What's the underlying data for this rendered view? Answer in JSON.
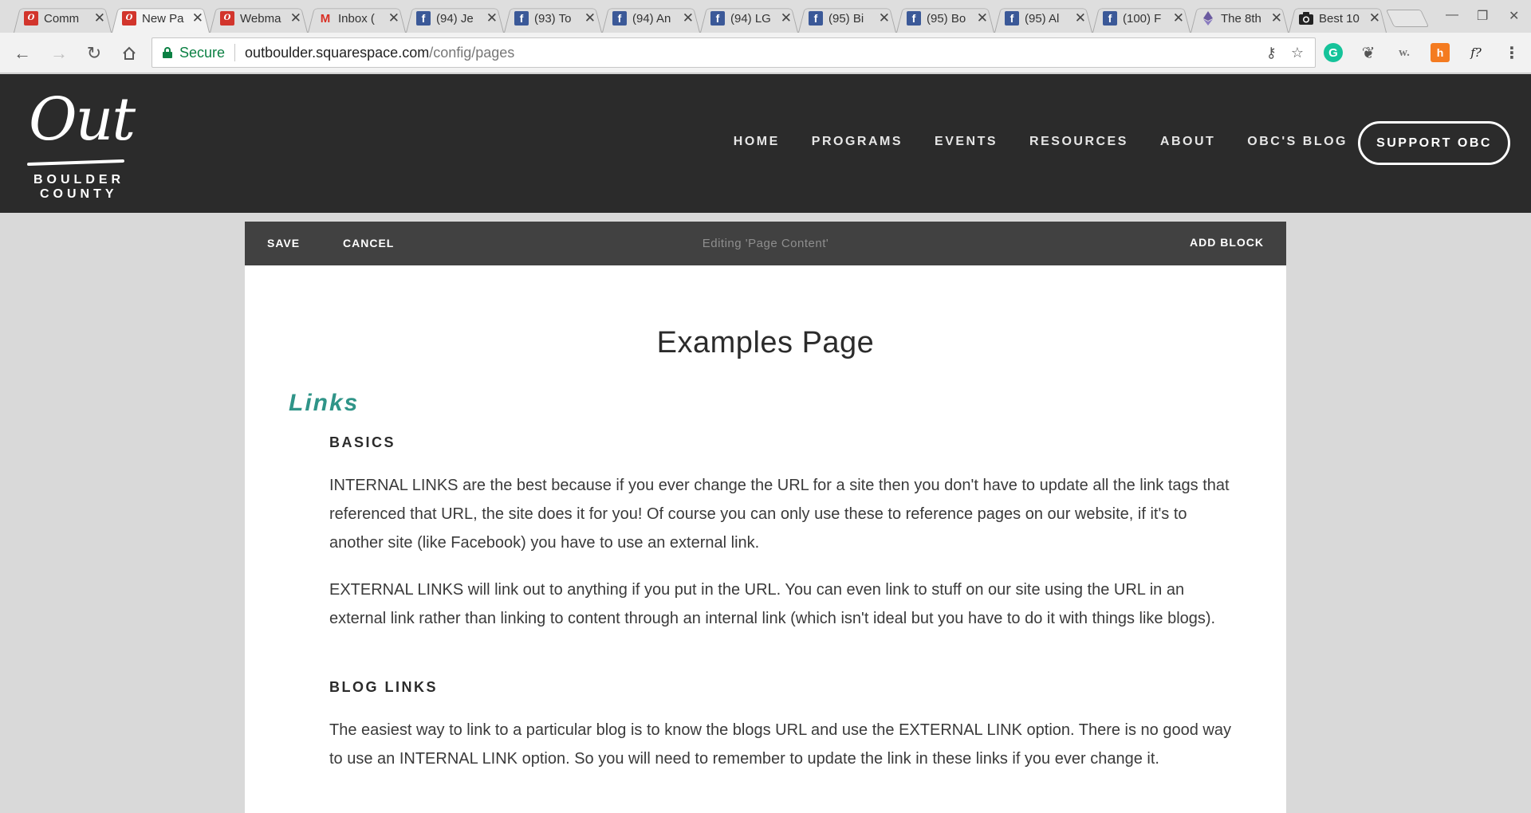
{
  "browser": {
    "tabs": [
      {
        "title": "Comm",
        "favicon": "out-logo-icon"
      },
      {
        "title": "New Pa",
        "favicon": "out-logo-icon",
        "active": true
      },
      {
        "title": "Webma",
        "favicon": "out-logo-icon"
      },
      {
        "title": "Inbox (",
        "favicon": "gmail-icon"
      },
      {
        "title": "(94) Je",
        "favicon": "facebook-icon"
      },
      {
        "title": "(93) To",
        "favicon": "facebook-icon"
      },
      {
        "title": "(94) An",
        "favicon": "facebook-icon"
      },
      {
        "title": "(94) LG",
        "favicon": "facebook-icon"
      },
      {
        "title": "(95) Bi",
        "favicon": "facebook-icon"
      },
      {
        "title": "(95) Bo",
        "favicon": "facebook-icon"
      },
      {
        "title": "(95) Al",
        "favicon": "facebook-icon"
      },
      {
        "title": "(100) F",
        "favicon": "facebook-icon"
      },
      {
        "title": "The 8th",
        "favicon": "ethereum-icon"
      },
      {
        "title": "Best 10",
        "favicon": "camera-icon"
      }
    ],
    "omnibox": {
      "secure_label": "Secure",
      "host": "outboulder.squarespace.com",
      "path": "/config/pages"
    }
  },
  "site": {
    "logo": {
      "wordmark": "Out",
      "line1": "BOULDER",
      "line2": "COUNTY"
    },
    "nav": [
      "HOME",
      "PROGRAMS",
      "EVENTS",
      "RESOURCES",
      "ABOUT",
      "OBC'S BLOG"
    ],
    "support_button": "SUPPORT OBC"
  },
  "editor": {
    "save": "SAVE",
    "cancel": "CANCEL",
    "status": "Editing 'Page Content'",
    "add_block": "ADD BLOCK"
  },
  "content": {
    "page_title": "Examples Page",
    "section_heading": "Links",
    "basics_heading": "BASICS",
    "internal_links_text": "INTERNAL LINKS are the best because if you ever change the URL for a site then you don't have to update all the link tags that referenced that URL, the site does it for you! Of course you can only use these to reference pages on our website, if it's to another site (like Facebook) you have to use an external link.",
    "external_links_text": "EXTERNAL LINKS will link out to anything if you put in the URL. You can even link to stuff on our site using the URL in an external link rather than linking to content through an internal link (which isn't ideal but you have to do it with things like blogs).",
    "blog_links_heading": "BLOG LINKS",
    "blog_links_text": "The easiest way to link to a particular blog is to know the blogs URL and use the EXTERNAL LINK option. There is no good way to use an INTERNAL LINK option. So you will need to remember to update the link in these links if you ever change it."
  },
  "colors": {
    "header_bg": "#2b2b2b",
    "editbar_bg": "#414141",
    "accent_teal": "#2f9488",
    "secure_green": "#0b8043"
  }
}
